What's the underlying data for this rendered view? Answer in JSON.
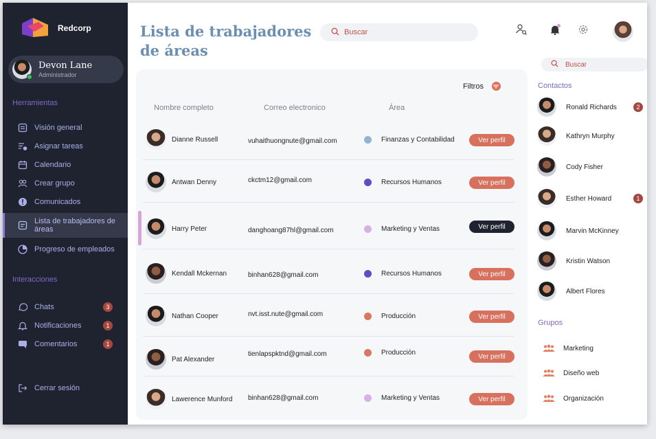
{
  "sidebar": {
    "brand": "Redcorp",
    "user": {
      "name": "Devon Lane",
      "role": "Administrador"
    },
    "tools_title": "Herramientas",
    "tools": [
      {
        "label": "Visión general",
        "icon": "overview-icon"
      },
      {
        "label": "Asignar tareas",
        "icon": "tasks-icon"
      },
      {
        "label": "Calendario",
        "icon": "calendar-icon"
      },
      {
        "label": "Crear grupo",
        "icon": "group-icon"
      },
      {
        "label": "Comunicados",
        "icon": "alert-icon"
      },
      {
        "label": "Lista de trabajadores de áreas",
        "icon": "list-icon"
      },
      {
        "label": "Progreso de empleados",
        "icon": "progress-icon"
      }
    ],
    "interactions_title": "Interacciones",
    "interactions": [
      {
        "label": "Chats",
        "badge": "3",
        "icon": "chat-icon"
      },
      {
        "label": "Notificaciones",
        "badge": "1",
        "icon": "bell-icon"
      },
      {
        "label": "Comentarios",
        "badge": "1",
        "icon": "comment-icon"
      }
    ],
    "logout": "Cerrar sesión"
  },
  "header": {
    "title_line1": "Lista de trabajadores",
    "title_line2": "de áreas",
    "search_placeholder": "Buscar"
  },
  "table": {
    "filters_label": "Filtros",
    "columns": [
      "Nombre completo",
      "Correo electronico",
      "Área"
    ],
    "button_label": "Ver perfil",
    "rows": [
      {
        "name": "Dianne Russell",
        "email": "vuhaithuongnute@gmail.com",
        "area": "Finanzas y Contabilidad",
        "dot": "#8fb5d6"
      },
      {
        "name": "Antwan Denny",
        "email": "ckctm12@gmail.com",
        "area": "Recursos Humanos",
        "dot": "#5b4fc4"
      },
      {
        "name": "Harry Peter",
        "email": "danghoang87hl@gmail.com",
        "area": "Marketing y Ventas",
        "dot": "#d6b0e6"
      },
      {
        "name": "Kendall Mckernan",
        "email": "binhan628@gmail.com",
        "area": "Recursos Humanos",
        "dot": "#5b4fc4"
      },
      {
        "name": "Nathan Cooper",
        "email": "nvt.isst.nute@gmail.com",
        "area": "Producción",
        "dot": "#d9775f"
      },
      {
        "name": "Pat Alexander",
        "email": "tienlapspktnd@gmail.com",
        "area": "Producción",
        "dot": "#d9775f"
      },
      {
        "name": "Lawerence Munford",
        "email": "binhan628@gmail.com",
        "area": "Marketing y Ventas",
        "dot": "#d6b0e6"
      }
    ]
  },
  "right_panel": {
    "search_placeholder": "Buscar",
    "contacts_title": "Contactos",
    "contacts": [
      {
        "name": "Ronald Richards",
        "badge": "2"
      },
      {
        "name": "Kathryn Murphy",
        "badge": ""
      },
      {
        "name": "Cody Fisher",
        "badge": ""
      },
      {
        "name": "Esther Howard",
        "badge": "1"
      },
      {
        "name": "Marvin McKinney",
        "badge": ""
      },
      {
        "name": "Kristin Watson",
        "badge": ""
      },
      {
        "name": "Albert Flores",
        "badge": ""
      }
    ],
    "groups_title": "Grupos",
    "groups": [
      "Marketing",
      "Diseño web",
      "Organización"
    ]
  },
  "colors": {
    "sidebar_bg": "#1f2330",
    "accent": "#d8705e",
    "title": "#6b8fb3",
    "section": "#7f68c9"
  }
}
